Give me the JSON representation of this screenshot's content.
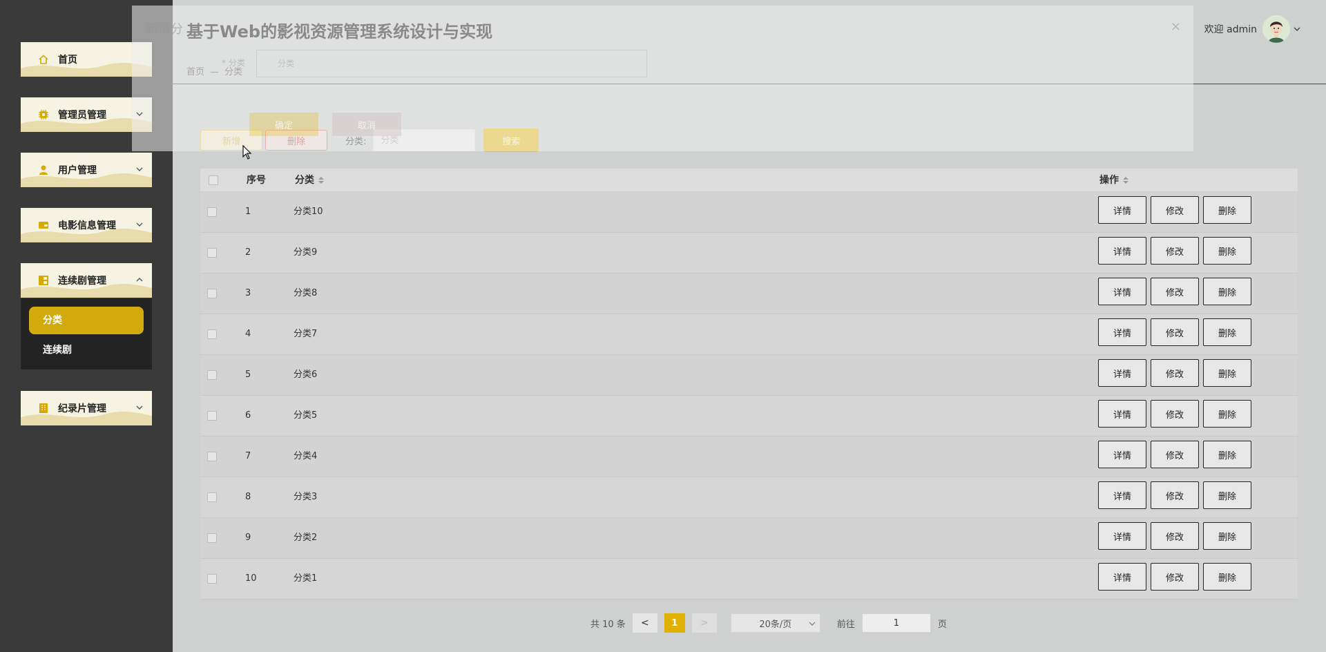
{
  "app": {
    "title": "基于Web的影视资源管理系统设计与实现"
  },
  "breadcrumb": {
    "home": "首页",
    "separator": "—",
    "current": "分类"
  },
  "user": {
    "welcome": "欢迎 admin"
  },
  "sidebar": {
    "items": [
      {
        "label": "首页",
        "icon": "home-icon",
        "expandable": false
      },
      {
        "label": "管理员管理",
        "icon": "admin-icon",
        "expandable": true
      },
      {
        "label": "用户管理",
        "icon": "user-icon",
        "expandable": true
      },
      {
        "label": "电影信息管理",
        "icon": "wallet-icon",
        "expandable": true
      },
      {
        "label": "连续剧管理",
        "icon": "layout-icon",
        "expandable": true,
        "expanded": true
      },
      {
        "label": "纪录片管理",
        "icon": "building-icon",
        "expandable": true
      }
    ],
    "submenu": {
      "active": "分类",
      "other": "连续剧"
    }
  },
  "toolbar": {
    "add_label": "新增",
    "delete_label": "删除",
    "filter_label": "分类:",
    "filter_placeholder": "分类",
    "search_label": "搜索"
  },
  "table": {
    "headers": {
      "index": "序号",
      "category": "分类",
      "actions": "操作"
    },
    "action_labels": {
      "detail": "详情",
      "edit": "修改",
      "delete": "删除"
    },
    "rows": [
      {
        "index": "1",
        "category": "分类10"
      },
      {
        "index": "2",
        "category": "分类9"
      },
      {
        "index": "3",
        "category": "分类8"
      },
      {
        "index": "4",
        "category": "分类7"
      },
      {
        "index": "5",
        "category": "分类6"
      },
      {
        "index": "6",
        "category": "分类5"
      },
      {
        "index": "7",
        "category": "分类4"
      },
      {
        "index": "8",
        "category": "分类3"
      },
      {
        "index": "9",
        "category": "分类2"
      },
      {
        "index": "10",
        "category": "分类1"
      }
    ]
  },
  "pagination": {
    "total": "共 10 条",
    "prev": "<",
    "next": ">",
    "current_page": "1",
    "page_size": "20条/页",
    "goto_label": "前往",
    "goto_value": "1",
    "page_suffix": "页"
  },
  "ghost_modal": {
    "title": "新增分",
    "close": "×",
    "field_label": "* 分类",
    "field_placeholder": "分类",
    "ok": "确定",
    "cancel": "取消"
  },
  "colors": {
    "accent": "#e0b100",
    "sidebar_bg": "#3a3a3a",
    "menu_item_bg": "#f7f3e2",
    "menu_wave": "#e8dcac",
    "submenu_active": "#d1ab0c",
    "danger": "#d34848"
  }
}
